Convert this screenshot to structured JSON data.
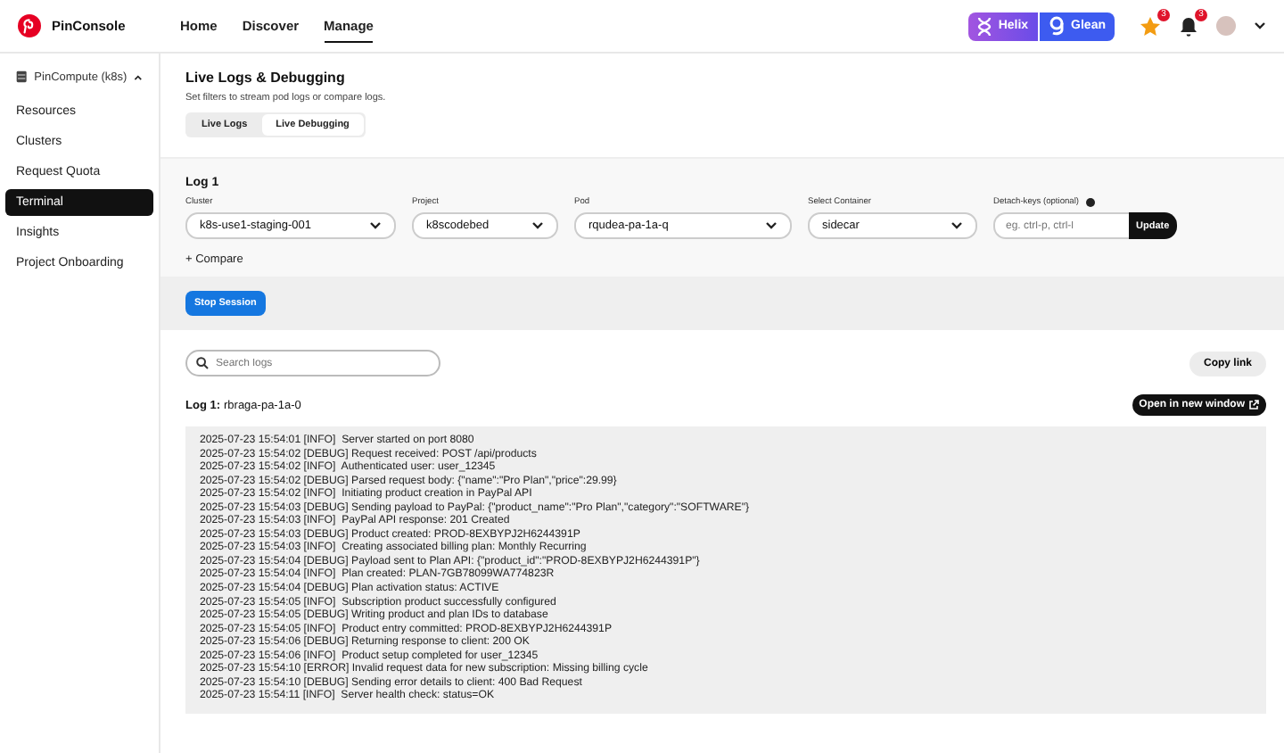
{
  "header": {
    "brand": "PinConsole",
    "nav": [
      {
        "label": "Home",
        "selected": false
      },
      {
        "label": "Discover",
        "selected": false
      },
      {
        "label": "Manage",
        "selected": true
      }
    ],
    "helix": "Helix",
    "glean": "Glean",
    "star_badge": "3",
    "bell_badge": "3"
  },
  "sidebar": {
    "group": "PinCompute (k8s)",
    "expanded": true,
    "items": [
      {
        "label": "Resources",
        "selected": false
      },
      {
        "label": "Clusters",
        "selected": false
      },
      {
        "label": "Request Quota",
        "selected": false
      },
      {
        "label": "Terminal",
        "selected": true
      },
      {
        "label": "Insights",
        "selected": false
      },
      {
        "label": "Project Onboarding",
        "selected": false
      }
    ]
  },
  "page": {
    "title": "Live Logs & Debugging",
    "subtitle": "Set filters to stream pod logs or compare logs.",
    "tabs": [
      {
        "label": "Live Logs",
        "selected": false
      },
      {
        "label": "Live Debugging",
        "selected": true
      }
    ]
  },
  "log_form": {
    "title": "Log 1",
    "selects": [
      {
        "label": "Cluster",
        "value": "k8s-use1-staging-001"
      },
      {
        "label": "Project",
        "value": "k8scodebed"
      },
      {
        "label": "Pod",
        "value": "rqudea-pa-1a-q"
      },
      {
        "label": "Select Container",
        "value": "sidecar"
      }
    ],
    "detach_label": "Detach-keys (optional)",
    "detach_placeholder": "eg. ctrl-p, ctrl-l",
    "update": "Update",
    "compare": "+ Compare"
  },
  "stop_session": "Stop Session",
  "logs": {
    "search_placeholder": "Search logs",
    "copy_link": "Copy link",
    "log_label": "Log 1:",
    "log_name": "rbraga-pa-1a-0",
    "open_new": "Open in new window",
    "lines": [
      "2025-07-23 15:54:01 [INFO]  Server started on port 8080",
      "2025-07-23 15:54:02 [DEBUG] Request received: POST /api/products",
      "2025-07-23 15:54:02 [INFO]  Authenticated user: user_12345",
      "2025-07-23 15:54:02 [DEBUG] Parsed request body: {\"name\":\"Pro Plan\",\"price\":29.99}",
      "2025-07-23 15:54:02 [INFO]  Initiating product creation in PayPal API",
      "2025-07-23 15:54:03 [DEBUG] Sending payload to PayPal: {\"product_name\":\"Pro Plan\",\"category\":\"SOFTWARE\"}",
      "2025-07-23 15:54:03 [INFO]  PayPal API response: 201 Created",
      "2025-07-23 15:54:03 [DEBUG] Product created: PROD-8EXBYPJ2H6244391P",
      "2025-07-23 15:54:03 [INFO]  Creating associated billing plan: Monthly Recurring",
      "2025-07-23 15:54:04 [DEBUG] Payload sent to Plan API: {\"product_id\":\"PROD-8EXBYPJ2H6244391P\"}",
      "2025-07-23 15:54:04 [INFO]  Plan created: PLAN-7GB78099WA774823R",
      "2025-07-23 15:54:04 [DEBUG] Plan activation status: ACTIVE",
      "2025-07-23 15:54:05 [INFO]  Subscription product successfully configured",
      "2025-07-23 15:54:05 [DEBUG] Writing product and plan IDs to database",
      "2025-07-23 15:54:05 [INFO]  Product entry committed: PROD-8EXBYPJ2H6244391P",
      "2025-07-23 15:54:06 [DEBUG] Returning response to client: 200 OK",
      "2025-07-23 15:54:06 [INFO]  Product setup completed for user_12345",
      "2025-07-23 15:54:10 [ERROR] Invalid request data for new subscription: Missing billing cycle",
      "2025-07-23 15:54:10 [DEBUG] Sending error details to client: 400 Bad Request",
      "2025-07-23 15:54:11 [INFO]  Server health check: status=OK"
    ]
  }
}
